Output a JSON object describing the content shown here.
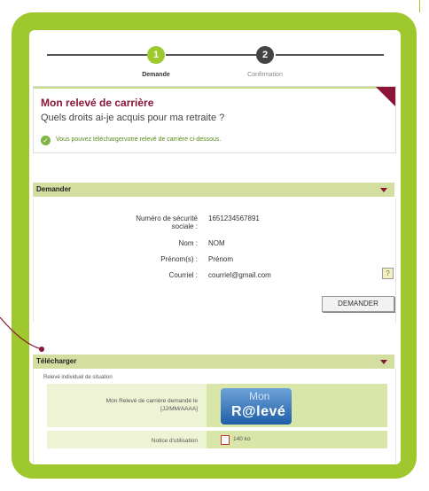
{
  "stepper": {
    "steps": [
      {
        "number": "1",
        "label": "Demande",
        "active": true
      },
      {
        "number": "2",
        "label": "Confirmation",
        "active": false
      }
    ]
  },
  "header": {
    "title": "Mon relevé de carrière",
    "subtitle": "Quels droits ai-je acquis pour ma retraite ?",
    "message": "Vous pouvez téléchargervotre relevé de carrière ci-dessous.",
    "message_icon": "check-icon"
  },
  "demander": {
    "section_label": "Demander",
    "fields": [
      {
        "label": "Numéro de sécurité\nsociale :",
        "value": "1651234567891"
      },
      {
        "label": "Nom :",
        "value": "NOM"
      },
      {
        "label": "Prénom(s) :",
        "value": "Prénom"
      },
      {
        "label": "Courriel :",
        "value": "courriel@gmail.com"
      }
    ],
    "help_icon": "?",
    "button": "DEMANDER"
  },
  "telecharger": {
    "section_label": "Télécharger",
    "caption": "Relevé individuel de situation",
    "rows": [
      {
        "label": "Mon Relevé de carrière demandé le [JJ/MM/AAAA]",
        "logo_top": "Mon",
        "logo_main": "R@levé"
      },
      {
        "label": "Notice d'utilisation",
        "file_size": "140 ko"
      }
    ]
  },
  "colors": {
    "frame": "#9ec82d",
    "accent": "#8a1538",
    "section_bar": "#d3dea0"
  }
}
